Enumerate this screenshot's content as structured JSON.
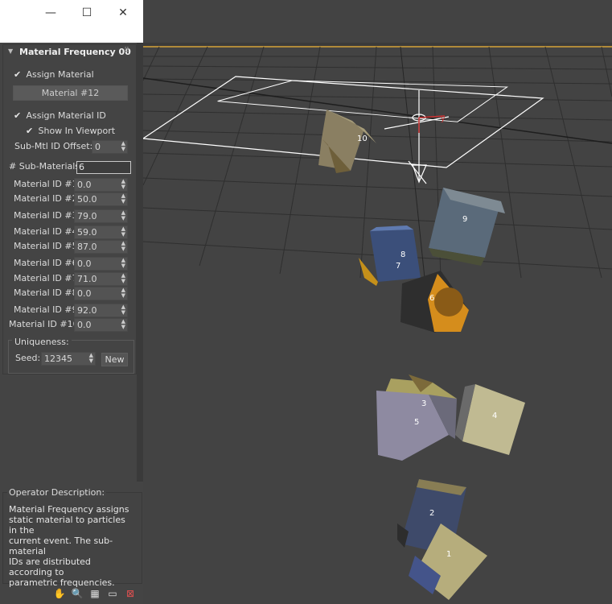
{
  "window": {
    "minimize_glyph": "—",
    "maximize_glyph": "☐",
    "close_glyph": "✕"
  },
  "rollout": {
    "title": "Material Frequency 00",
    "assign_material_label": "Assign Material",
    "assign_material_checked": true,
    "material_button_label": "Material #12",
    "assign_material_id_label": "Assign Material ID",
    "assign_material_id_checked": true,
    "show_in_viewport_label": "Show In Viewport",
    "show_in_viewport_checked": true,
    "sub_mtl_offset_label": "Sub-Mtl ID Offset:",
    "sub_mtl_offset_value": "0",
    "sub_materials_label": "# Sub-Materials:",
    "sub_materials_value": "6",
    "material_ids": [
      {
        "label": "Material ID #1:",
        "value": "0.0"
      },
      {
        "label": "Material ID #2:",
        "value": "50.0"
      },
      {
        "label": "Material ID #3:",
        "value": "79.0"
      },
      {
        "label": "Material ID #4:",
        "value": "59.0"
      },
      {
        "label": "Material ID #5:",
        "value": "87.0"
      },
      {
        "label": "Material ID #6:",
        "value": "0.0"
      },
      {
        "label": "Material ID #7:",
        "value": "71.0"
      },
      {
        "label": "Material ID #8:",
        "value": "0.0"
      },
      {
        "label": "Material ID #9:",
        "value": "92.0"
      },
      {
        "label": "Material ID #10:",
        "value": "0.0"
      }
    ],
    "uniqueness_label": "Uniqueness:",
    "seed_label": "Seed:",
    "seed_value": "12345",
    "new_button_label": "New"
  },
  "description": {
    "heading": "Operator Description:",
    "text": "Material Frequency assigns\nstatic material to particles in the\ncurrent event. The sub-material\nIDs are distributed according to\nparametric frequencies."
  },
  "toolbar_icons": [
    "hand-icon",
    "magnify-icon",
    "region-zoom-icon",
    "window-icon",
    "no-select-icon"
  ],
  "viewport": {
    "particle_labels": [
      "1",
      "2",
      "3",
      "4",
      "5",
      "6",
      "7",
      "8",
      "9",
      "10"
    ],
    "gizmo_axis_label": "y",
    "accent_color": "#c8a040"
  }
}
